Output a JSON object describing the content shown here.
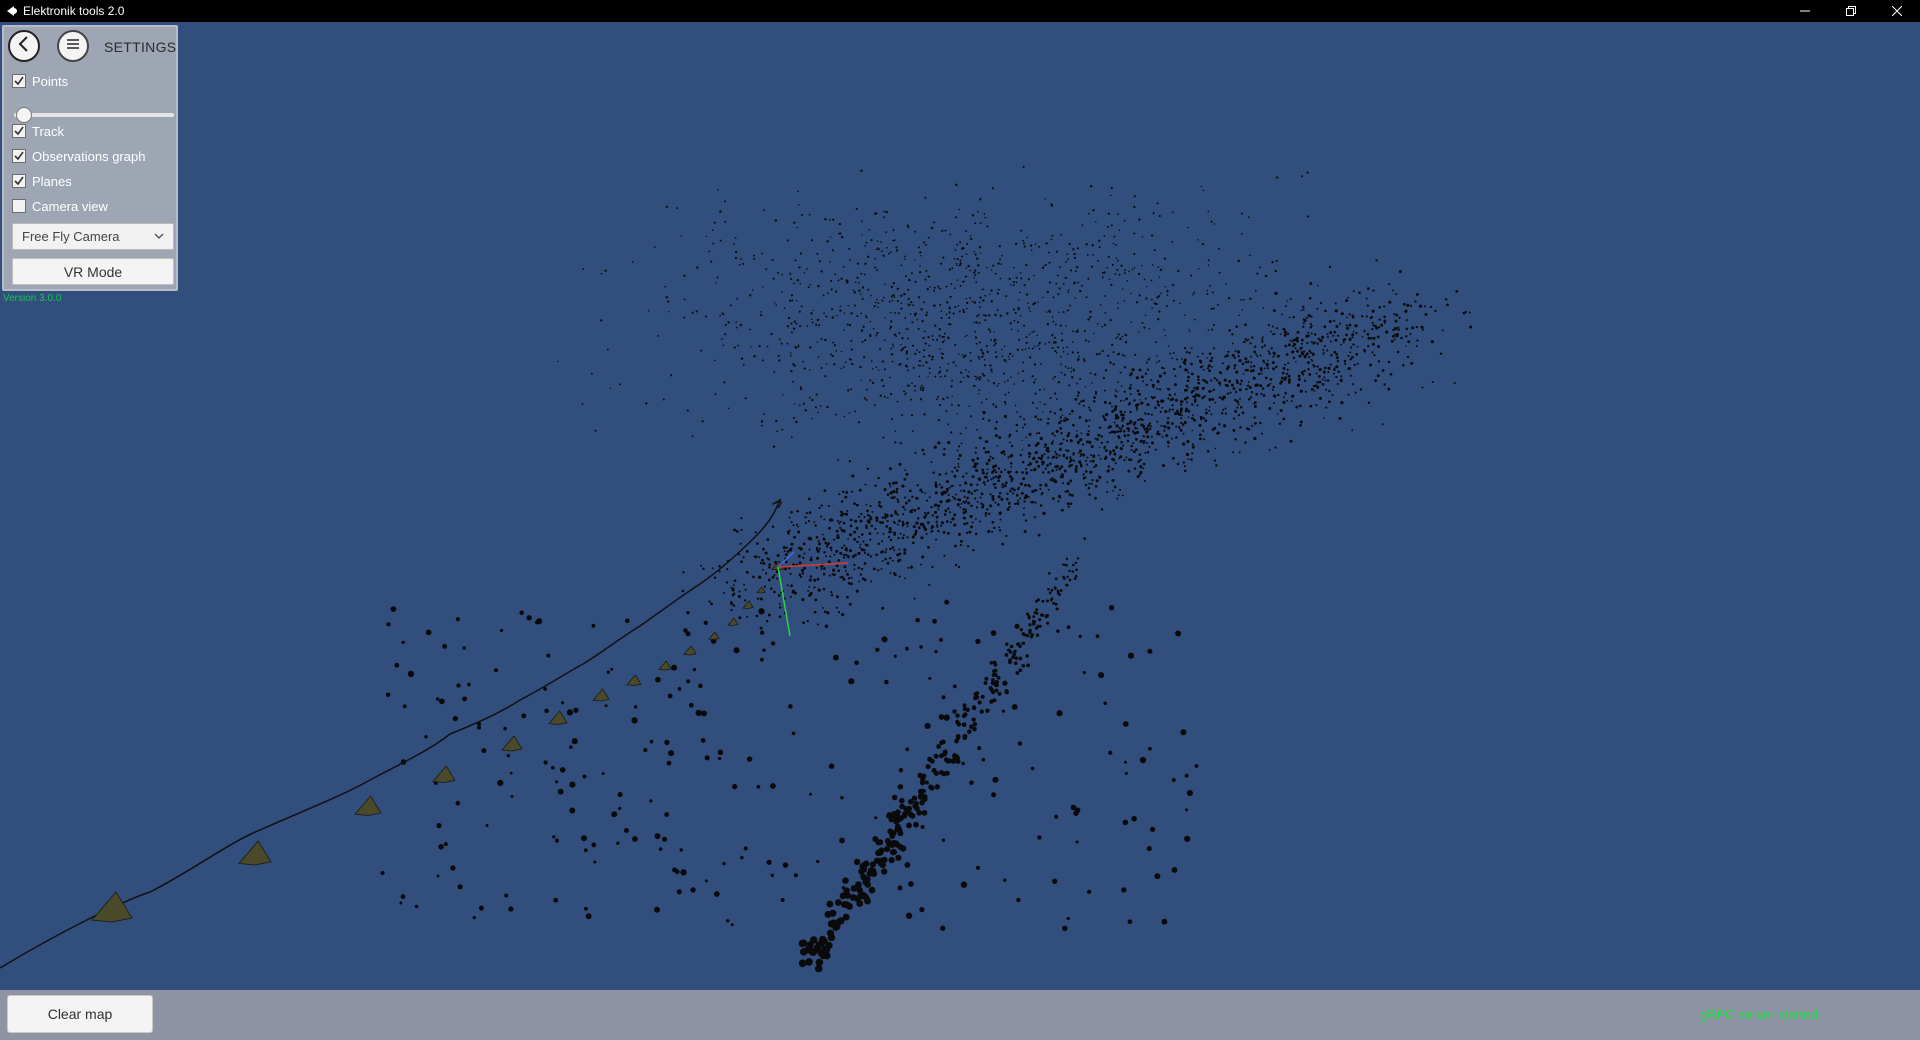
{
  "window": {
    "title": "Elektronik tools 2.0",
    "controls": [
      "minimize",
      "restore",
      "close"
    ]
  },
  "settings": {
    "title": "SETTINGS",
    "options": [
      {
        "label": "Points",
        "checked": true
      },
      {
        "label": "Track",
        "checked": true
      },
      {
        "label": "Observations graph",
        "checked": true
      },
      {
        "label": "Planes",
        "checked": true
      },
      {
        "label": "Camera view",
        "checked": false
      }
    ],
    "point_size_slider": 0.0,
    "camera_mode": "Free Fly Camera",
    "vr_button": "VR Mode"
  },
  "version": "Version 3.0.0",
  "bottom": {
    "clear_button": "Clear map",
    "status": "gRPC server started"
  },
  "colors": {
    "viewport_bg": "#324e7c",
    "panel_bg": "#9ea6b4",
    "status_green": "#18e03f",
    "axis_x": "#d23c3c",
    "axis_y": "#2fd04a",
    "axis_z": "#3e6cf0"
  },
  "icons": {
    "back": "back-arrow-icon",
    "menu": "hamburger-menu-icon",
    "dropdown": "chevron-down-icon"
  }
}
